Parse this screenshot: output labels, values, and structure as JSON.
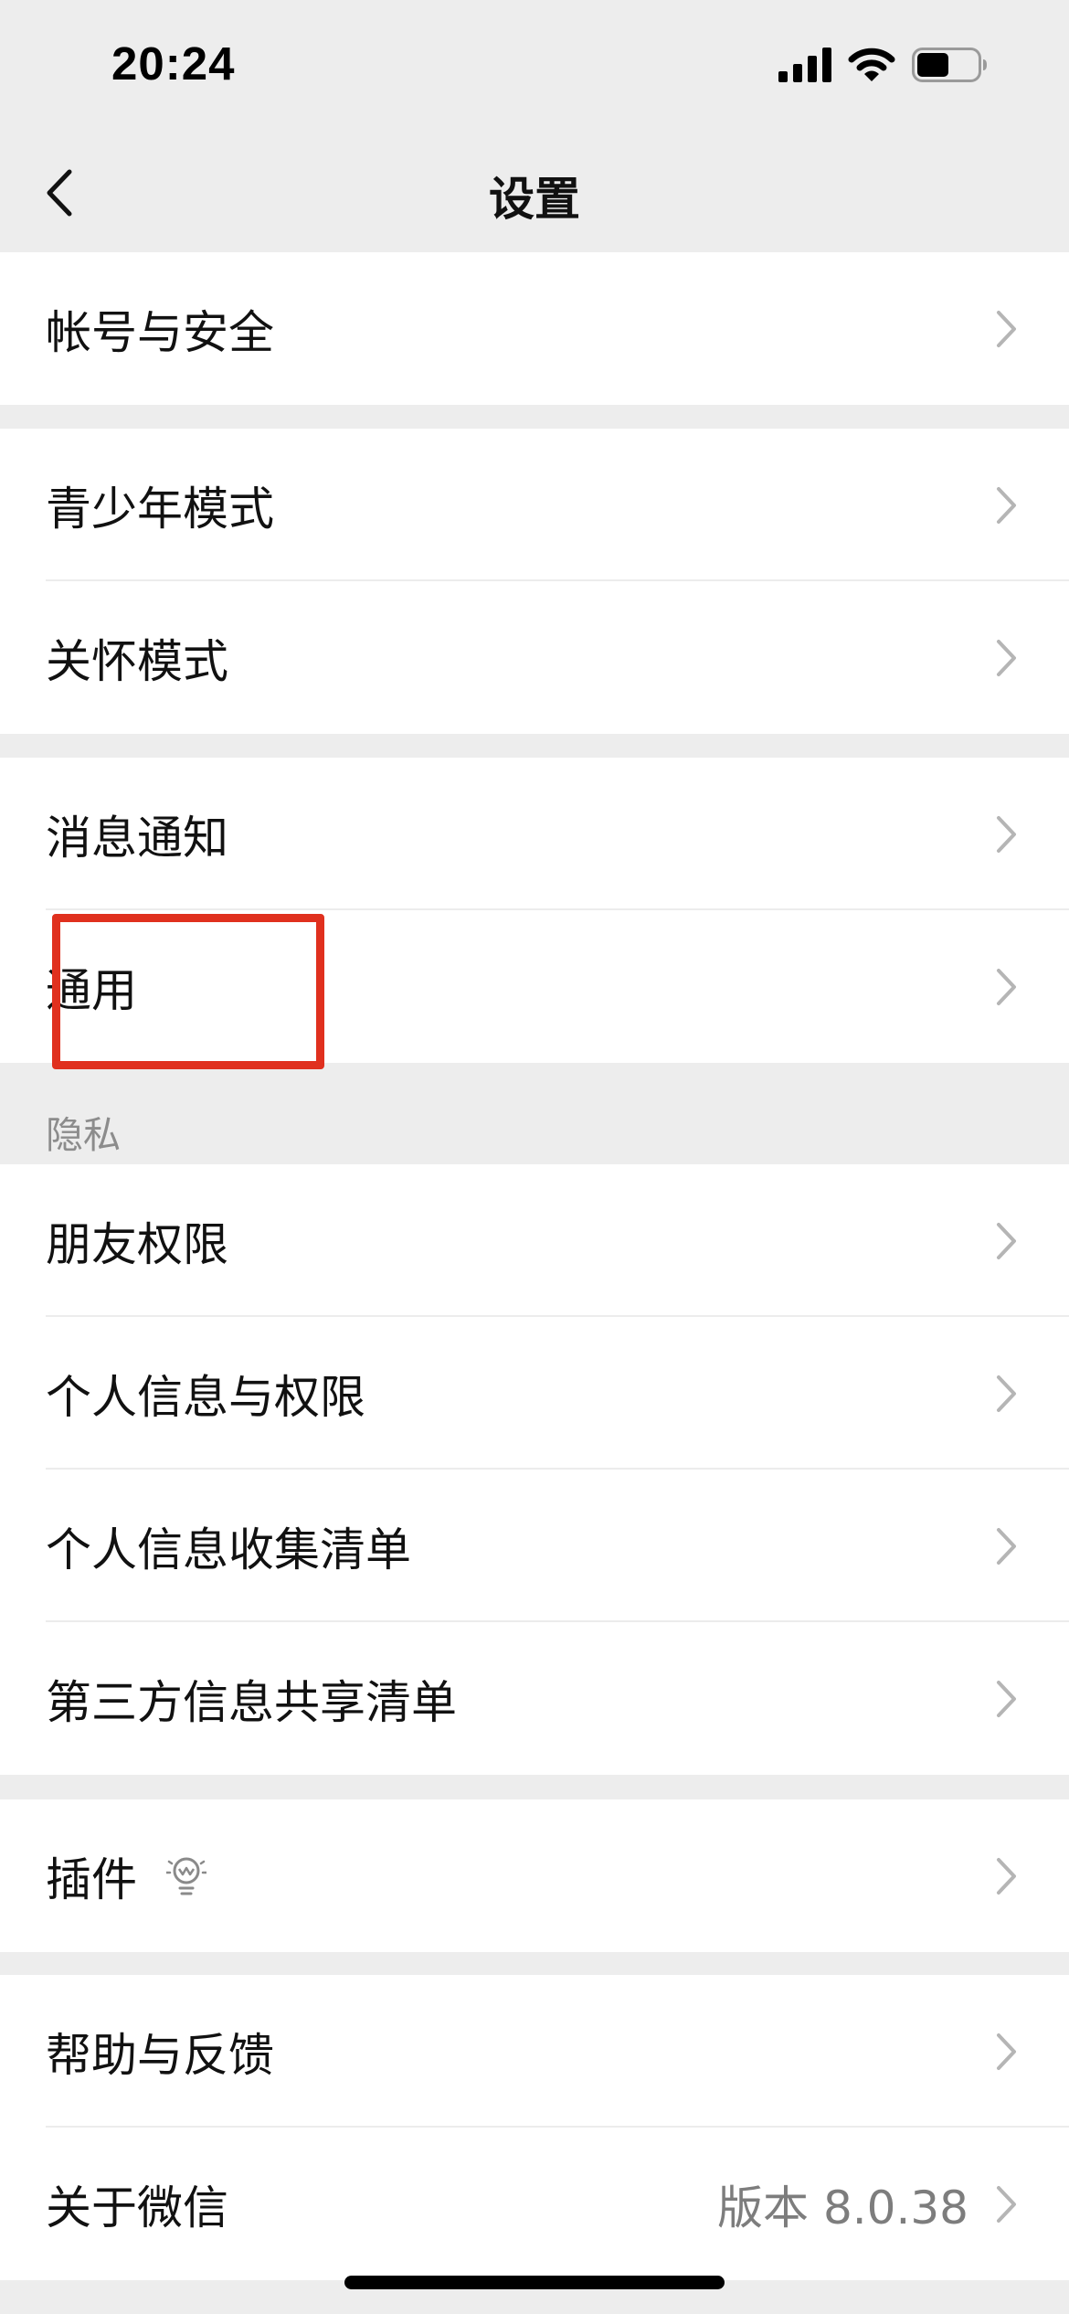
{
  "status_bar": {
    "time": "20:24",
    "icons": [
      "signal-icon",
      "wifi-icon",
      "battery-icon"
    ]
  },
  "nav": {
    "title": "设置",
    "back_icon": "chevron-left-icon"
  },
  "groups": [
    {
      "items": [
        {
          "label": "帐号与安全"
        }
      ]
    },
    {
      "items": [
        {
          "label": "青少年模式"
        },
        {
          "label": "关怀模式"
        }
      ]
    },
    {
      "items": [
        {
          "label": "消息通知"
        },
        {
          "label": "通用"
        }
      ]
    },
    {
      "header": "隐私",
      "items": [
        {
          "label": "朋友权限"
        },
        {
          "label": "个人信息与权限"
        },
        {
          "label": "个人信息收集清单"
        },
        {
          "label": "第三方信息共享清单"
        }
      ]
    },
    {
      "items": [
        {
          "label": "插件",
          "icon": "lightbulb-icon"
        }
      ]
    },
    {
      "items": [
        {
          "label": "帮助与反馈"
        },
        {
          "label": "关于微信",
          "value": "版本 8.0.38"
        }
      ]
    }
  ],
  "colors": {
    "background": "#ededed",
    "card": "#ffffff",
    "highlight_border": "#e0301e",
    "secondary_text": "#7d7d7d"
  }
}
